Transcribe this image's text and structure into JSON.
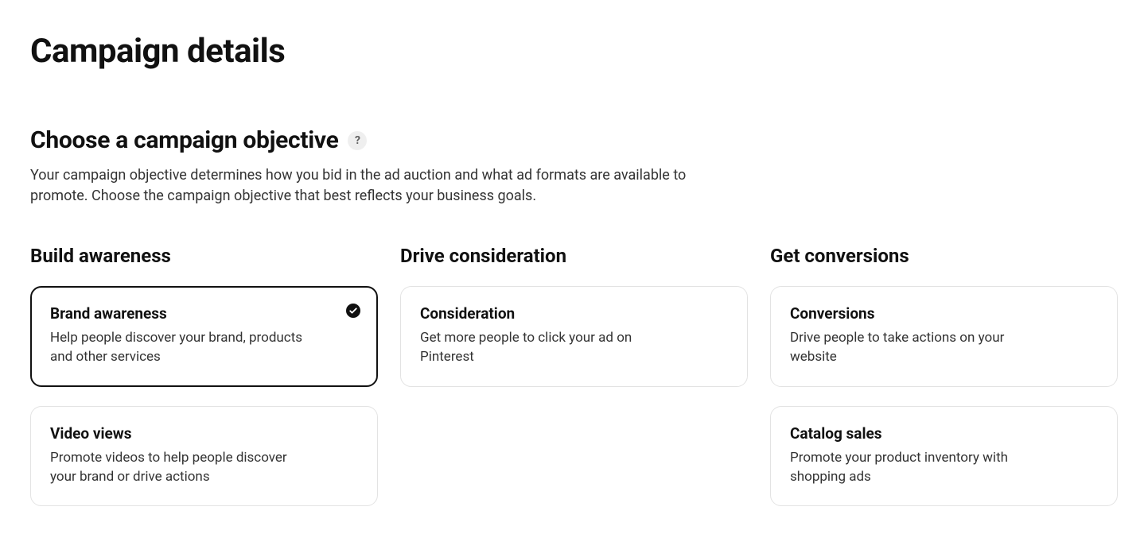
{
  "page_title": "Campaign details",
  "section": {
    "heading": "Choose a campaign objective",
    "help_label": "?",
    "description": "Your campaign objective determines how you bid in the ad auction and what ad formats are available to promote. Choose the campaign objective that best reflects your business goals."
  },
  "columns": {
    "awareness": {
      "title": "Build awareness",
      "cards": {
        "brand_awareness": {
          "title": "Brand awareness",
          "description": "Help people discover your brand, products and other services"
        },
        "video_views": {
          "title": "Video views",
          "description": "Promote videos to help people discover your brand or drive actions"
        }
      }
    },
    "consideration": {
      "title": "Drive consideration",
      "cards": {
        "consideration": {
          "title": "Consideration",
          "description": "Get more people to click your ad on Pinterest"
        }
      }
    },
    "conversions": {
      "title": "Get conversions",
      "cards": {
        "conversions": {
          "title": "Conversions",
          "description": "Drive people to take actions on your website"
        },
        "catalog_sales": {
          "title": "Catalog sales",
          "description": "Promote your product inventory with shopping ads"
        }
      }
    }
  }
}
